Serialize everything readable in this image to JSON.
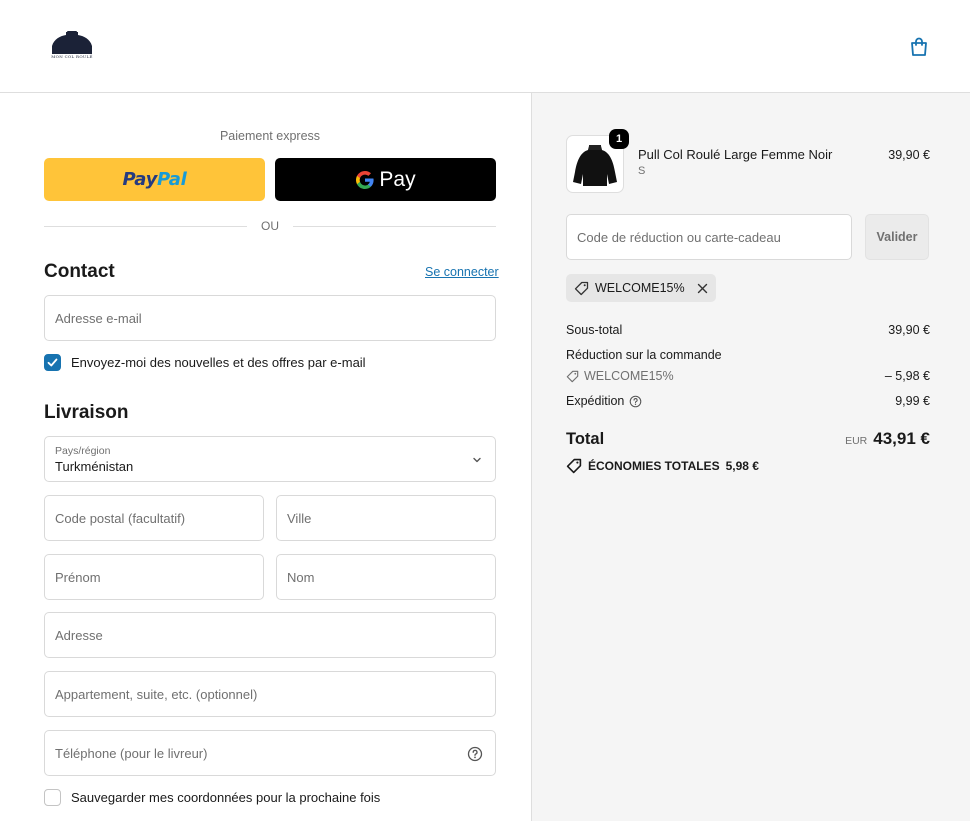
{
  "header": {
    "logo_text": "MON COL ROULÉ",
    "cart_icon": "shopping-bag-icon"
  },
  "express": {
    "title": "Paiement express",
    "paypal_part1": "Pay",
    "paypal_part2": "Pal",
    "gpay_label": "Pay",
    "divider_label": "OU"
  },
  "contact": {
    "title": "Contact",
    "signin_link": "Se connecter",
    "email_placeholder": "Adresse e-mail",
    "newsletter_label": "Envoyez-moi des nouvelles et des offres par e-mail",
    "newsletter_checked": true
  },
  "delivery": {
    "title": "Livraison",
    "country_label": "Pays/région",
    "country_value": "Turkménistan",
    "postal_placeholder": "Code postal (facultatif)",
    "city_placeholder": "Ville",
    "firstname_placeholder": "Prénom",
    "lastname_placeholder": "Nom",
    "address_placeholder": "Adresse",
    "apartment_placeholder": "Appartement, suite, etc. (optionnel)",
    "phone_placeholder": "Téléphone (pour le livreur)",
    "save_info_label": "Sauvegarder mes coordonnées pour la prochaine fois",
    "save_info_checked": false
  },
  "summary": {
    "product": {
      "name": "Pull Col Roulé Large Femme Noir",
      "variant": "S",
      "price": "39,90 €",
      "quantity": "1"
    },
    "discount_placeholder": "Code de réduction ou carte-cadeau",
    "apply_label": "Valider",
    "applied_code": "WELCOME15%",
    "subtotal_label": "Sous-total",
    "subtotal_value": "39,90 €",
    "order_discount_label": "Réduction sur la commande",
    "order_discount_code": "WELCOME15%",
    "order_discount_value": "– 5,98 €",
    "shipping_label": "Expédition",
    "shipping_value": "9,99 €",
    "total_label": "Total",
    "total_currency": "EUR",
    "total_value": "43,91 €",
    "savings_label": "ÉCONOMIES TOTALES",
    "savings_value": "5,98 €"
  },
  "colors": {
    "link": "#1773b0",
    "paypal_yellow": "#ffc439",
    "summary_bg": "#f5f5f5"
  }
}
